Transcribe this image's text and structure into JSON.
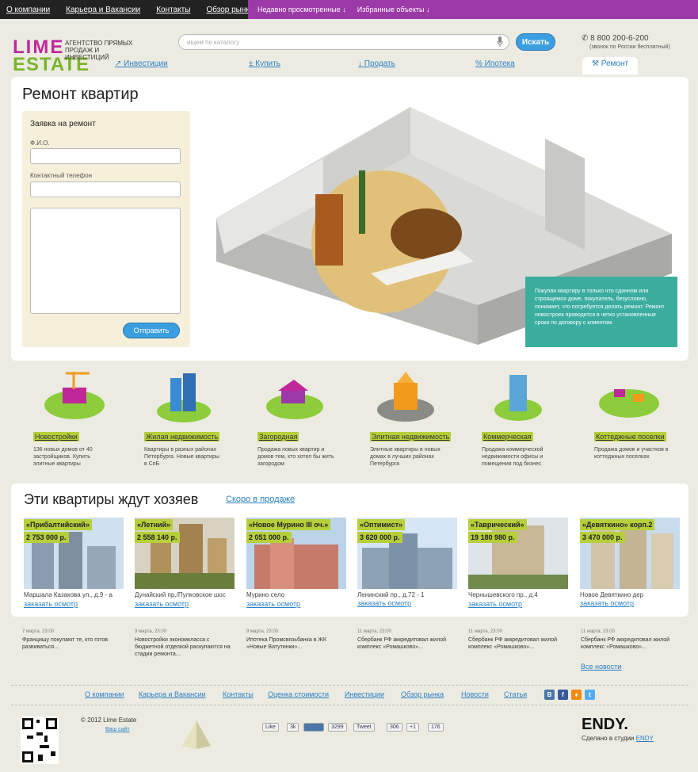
{
  "topbar": {
    "links": [
      "О компании",
      "Карьера и Вакансии",
      "Контакты",
      "Обзор рынка"
    ],
    "recent": "Недавно просмотренные ↓",
    "favorites": "Избранные объекты ↓"
  },
  "brand": {
    "line1": "LIME",
    "line2": "ESTATE",
    "tagline": "АГЕНТСТВО ПРЯМЫХ ПРОДАЖ И ИНВЕСТИЦИЙ",
    "colors": {
      "magenta": "#c0289a",
      "green": "#7ab52a",
      "orange": "#f19a1c",
      "blue": "#2a7fc4"
    }
  },
  "search": {
    "placeholder": "ищем по каталогу",
    "button": "Искать"
  },
  "contact": {
    "phone": "8 800 200-6-200",
    "note": "(звонок по России бесплатный)"
  },
  "nav": [
    "Инвестиции",
    "Купить",
    "Продать",
    "Ипотека",
    "Ремонт"
  ],
  "page": {
    "title": "Ремонт квартир"
  },
  "form": {
    "title": "Заявка на ремонт",
    "name_label": "Ф.И.О.",
    "phone_label": "Контактный телефон",
    "submit": "Отправить"
  },
  "callout": "Покупая квартиру в только что сданном или строящемся доме, покупатель, безусловно, понимает, что потребуется делать ремонт. Ремонт новостроек проводится в четко установленные сроки по договору с клиентом.",
  "categories": [
    {
      "label": "Новостройки",
      "desc": "136 новых домов от 40 застройщиков. Купить элитные квартиры"
    },
    {
      "label": "Жилая недвижимость",
      "desc": "Квартиры в разных районах Петербурга. Новые квартиры в СпБ"
    },
    {
      "label": "Загородная",
      "desc": "Продажа новых квартир и домов тем, кто хотел бы жить загородом"
    },
    {
      "label": "Элитная недвижимость",
      "desc": "Элитные квартиры в новых домах в лучших районах Петербурга"
    },
    {
      "label": "Коммерческая",
      "desc": "Продажа коммерческой недвижимости офисы и помещения под бизнес"
    },
    {
      "label": "Коттеджные поселки",
      "desc": "Продажа домов и участков в коттеджных поселках"
    }
  ],
  "apartments": {
    "title": "Эти квартиры ждут хозяев",
    "tab": "Скоро в продаже",
    "order": "заказать осмотр",
    "items": [
      {
        "name": "«Прибалтийский»",
        "price": "2 753 000 р.",
        "address": "Маршала Казакова ул., д.9 - а"
      },
      {
        "name": "«Летний»",
        "price": "2 558 140 р.",
        "address": "Дунайский пр./Пулковское шос"
      },
      {
        "name": "«Новое Мурино III оч.»",
        "price": "2 051 000 р.",
        "address": "Мурино село"
      },
      {
        "name": "«Оптимист»",
        "price": "3 620 000 р.",
        "address": "Ленинский пр., д.72 - 1"
      },
      {
        "name": "«Таврический»",
        "price": "19 180 980 р.",
        "address": "Чернышевского пр., д.4"
      },
      {
        "name": "«Девяткино» корп.2",
        "price": "3 470 000 р.",
        "address": "Новое Девяткино дер"
      }
    ]
  },
  "news": {
    "items": [
      {
        "date": "7 марта, 23:00",
        "text": "Францишу покупают те, кто готов развиваться..."
      },
      {
        "date": "9 марта, 23:00",
        "text": "Новостройки экономкласса с бюджетной отделкой раскупаются на стадии ремонта..."
      },
      {
        "date": "9 марта, 23:00",
        "text": "Ипотека Промсвязьбанка в ЖК «Новые Ватутинки»..."
      },
      {
        "date": "11 марта, 23:00",
        "text": "Сбербанк РФ аккредитовал жилой комплекс «Ромашково»..."
      },
      {
        "date": "11 марта, 23:00",
        "text": "Сбербанк РФ аккредитовал жилой комплекс «Ромашково»..."
      },
      {
        "date": "11 марта, 23:00",
        "text": "Сбербанк РФ аккредитовал жилой комплекс «Ромашково»..."
      }
    ],
    "all": "Все новости"
  },
  "footer": {
    "links": [
      "О компании",
      "Карьера и Вакансии",
      "Контакты",
      "Оценка стоимости",
      "Инвестиции",
      "Обзор рынка",
      "Новости",
      "Статьи"
    ],
    "social": [
      "B",
      "f",
      "t",
      "♦"
    ],
    "copyright": "© 2012  Lime Estate",
    "logo_link": "Ваш сайт",
    "share": [
      "Like",
      "3k",
      "3299",
      "Tweet",
      "306",
      "+1",
      "176"
    ],
    "studio_logo": "ENDY.",
    "studio_note": "Сделано в студии",
    "studio_link": "ENDY"
  }
}
